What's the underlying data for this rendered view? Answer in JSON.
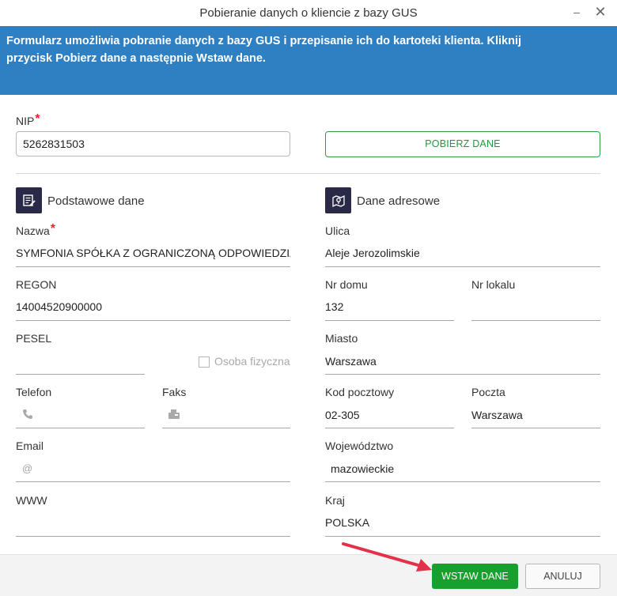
{
  "window": {
    "title": "Pobieranie danych o kliencie z bazy GUS",
    "minimize_glyph": "–",
    "close_glyph": "✕"
  },
  "banner": {
    "text_line1": "Formularz umożliwia pobranie danych z bazy GUS i przepisanie ich do kartoteki klienta. Kliknij",
    "text_line2": "przycisk Pobierz dane a następnie Wstaw dane."
  },
  "nip": {
    "label": "NIP",
    "required_mark": "*",
    "value": "5262831503"
  },
  "fetch_button": {
    "label": "POBIERZ DANE"
  },
  "basic": {
    "title": "Podstawowe dane",
    "icon": "document-edit-icon",
    "nazwa": {
      "label": "Nazwa",
      "required_mark": "*",
      "value": "SYMFONIA SPÓŁKA Z OGRANICZONĄ ODPOWIEDZIALNOŚCIĄ"
    },
    "regon": {
      "label": "REGON",
      "value": "14004520900000"
    },
    "pesel": {
      "label": "PESEL",
      "value": ""
    },
    "osoba_fizyczna": {
      "label": "Osoba fizyczna",
      "checked": false
    },
    "telefon": {
      "label": "Telefon",
      "value": "",
      "icon": "phone-icon"
    },
    "faks": {
      "label": "Faks",
      "value": "",
      "icon": "fax-icon"
    },
    "email": {
      "label": "Email",
      "value": "",
      "icon": "at-icon",
      "icon_glyph": "@"
    },
    "www": {
      "label": "WWW",
      "value": ""
    }
  },
  "address": {
    "title": "Dane adresowe",
    "icon": "map-pin-icon",
    "ulica": {
      "label": "Ulica",
      "value": "Aleje Jerozolimskie"
    },
    "nr_domu": {
      "label": "Nr domu",
      "value": "132"
    },
    "nr_lokalu": {
      "label": "Nr lokalu",
      "value": ""
    },
    "miasto": {
      "label": "Miasto",
      "value": "Warszawa"
    },
    "kod_pocztowy": {
      "label": "Kod pocztowy",
      "value": "02-305"
    },
    "poczta": {
      "label": "Poczta",
      "value": "Warszawa"
    },
    "wojewodztwo": {
      "label": "Województwo",
      "value": "mazowieckie"
    },
    "kraj": {
      "label": "Kraj",
      "value": "POLSKA"
    }
  },
  "footer": {
    "insert_button": "WSTAW DANE",
    "cancel_button": "ANULUJ"
  },
  "colors": {
    "banner": "#2f7fc3",
    "primary_green": "#18a02f",
    "required": "#e3262b",
    "arrow": "#e2324a",
    "section_icon_bg": "#2a2a48"
  }
}
